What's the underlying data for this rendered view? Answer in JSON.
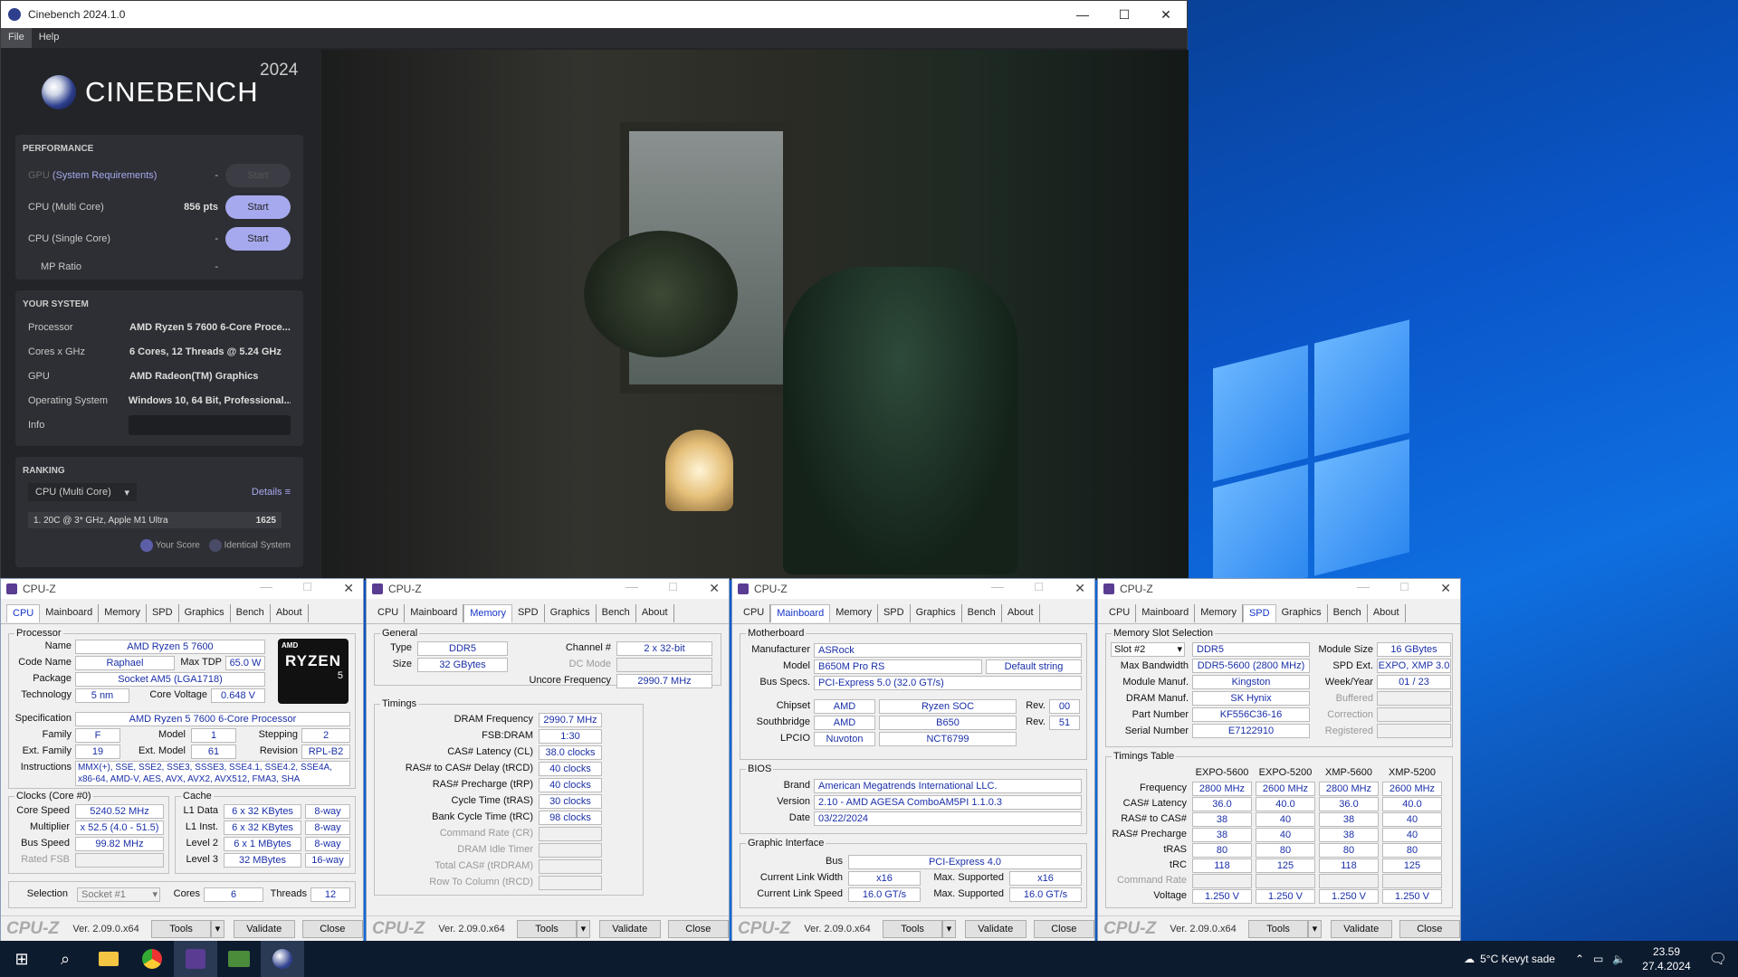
{
  "cinebench": {
    "title": "Cinebench 2024.1.0",
    "menu": [
      "File",
      "Help"
    ],
    "brand": "CINEBENCH",
    "year": "2024",
    "performance": {
      "heading": "PERFORMANCE",
      "rows": [
        {
          "label": "GPU",
          "link": "(System Requirements)",
          "value": "-",
          "button": "Start",
          "enabled": false
        },
        {
          "label": "CPU (Multi Core)",
          "value": "856 pts",
          "button": "Start",
          "enabled": true
        },
        {
          "label": "CPU (Single Core)",
          "value": "-",
          "button": "Start",
          "enabled": true
        },
        {
          "label": "MP Ratio",
          "value": "-"
        }
      ]
    },
    "system": {
      "heading": "YOUR SYSTEM",
      "rows": [
        {
          "k": "Processor",
          "v": "AMD Ryzen 5 7600 6-Core Proce..."
        },
        {
          "k": "Cores x GHz",
          "v": "6 Cores, 12 Threads @ 5.24 GHz"
        },
        {
          "k": "GPU",
          "v": "AMD Radeon(TM) Graphics"
        },
        {
          "k": "Operating System",
          "v": "Windows 10, 64 Bit, Professional..."
        },
        {
          "k": "Info",
          "v": ""
        }
      ]
    },
    "ranking": {
      "heading": "RANKING",
      "dropdown": "CPU (Multi Core)",
      "details": "Details",
      "entry": "1. 20C @ 3* GHz, Apple M1 Ultra",
      "score": "1625",
      "legend_your": "Your Score",
      "legend_identical": "Identical System"
    }
  },
  "cpuz_common": {
    "title": "CPU-Z",
    "tabs": [
      "CPU",
      "Mainboard",
      "Memory",
      "SPD",
      "Graphics",
      "Bench",
      "About"
    ],
    "brand": "CPU-Z",
    "version": "Ver. 2.09.0.x64",
    "tools": "Tools",
    "validate": "Validate",
    "close": "Close"
  },
  "cpu": {
    "g_processor": "Processor",
    "name_l": "Name",
    "name": "AMD Ryzen 5 7600",
    "code_l": "Code Name",
    "code": "Raphael",
    "tdp_l": "Max TDP",
    "tdp": "65.0 W",
    "pkg_l": "Package",
    "pkg": "Socket AM5 (LGA1718)",
    "tech_l": "Technology",
    "tech": "5 nm",
    "cv_l": "Core Voltage",
    "cv": "0.648 V",
    "spec_l": "Specification",
    "spec": "AMD Ryzen 5 7600 6-Core Processor",
    "fam_l": "Family",
    "fam": "F",
    "model_l": "Model",
    "model": "1",
    "step_l": "Stepping",
    "step": "2",
    "efam_l": "Ext. Family",
    "efam": "19",
    "emodel_l": "Ext. Model",
    "emodel": "61",
    "rev_l": "Revision",
    "rev": "RPL-B2",
    "instr_l": "Instructions",
    "instr": "MMX(+), SSE, SSE2, SSE3, SSSE3, SSE4.1, SSE4.2, SSE4A, x86-64, AMD-V, AES, AVX, AVX2, AVX512, FMA3, SHA",
    "clocks": "Clocks (Core #0)",
    "cs_l": "Core Speed",
    "cs": "5240.52 MHz",
    "mul_l": "Multiplier",
    "mul": "x 52.5 (4.0 - 51.5)",
    "bus_l": "Bus Speed",
    "bus": "99.82 MHz",
    "fsb_l": "Rated FSB",
    "cache": "Cache",
    "l1d_l": "L1 Data",
    "l1d": "6 x 32 KBytes",
    "l1d_w": "8-way",
    "l1i_l": "L1 Inst.",
    "l1i": "6 x 32 KBytes",
    "l1i_w": "8-way",
    "l2_l": "Level 2",
    "l2": "6 x 1 MBytes",
    "l2_w": "8-way",
    "l3_l": "Level 3",
    "l3": "32 MBytes",
    "l3_w": "16-way",
    "sel_l": "Selection",
    "sel": "Socket #1",
    "cores_l": "Cores",
    "cores": "6",
    "thr_l": "Threads",
    "thr": "12",
    "logo_top": "AMD",
    "logo_main": "RYZEN",
    "logo_num": "5"
  },
  "mem": {
    "general": "General",
    "type_l": "Type",
    "type": "DDR5",
    "ch_l": "Channel #",
    "ch": "2 x 32-bit",
    "size_l": "Size",
    "size": "32 GBytes",
    "dc_l": "DC Mode",
    "unc_l": "Uncore Frequency",
    "unc": "2990.7 MHz",
    "timings": "Timings",
    "rows": [
      {
        "l": "DRAM Frequency",
        "v": "2990.7 MHz",
        "d": false
      },
      {
        "l": "FSB:DRAM",
        "v": "1:30",
        "d": false
      },
      {
        "l": "CAS# Latency (CL)",
        "v": "38.0 clocks",
        "d": false
      },
      {
        "l": "RAS# to CAS# Delay (tRCD)",
        "v": "40 clocks",
        "d": false
      },
      {
        "l": "RAS# Precharge (tRP)",
        "v": "40 clocks",
        "d": false
      },
      {
        "l": "Cycle Time (tRAS)",
        "v": "30 clocks",
        "d": false
      },
      {
        "l": "Bank Cycle Time (tRC)",
        "v": "98 clocks",
        "d": false
      },
      {
        "l": "Command Rate (CR)",
        "v": "",
        "d": true
      },
      {
        "l": "DRAM Idle Timer",
        "v": "",
        "d": true
      },
      {
        "l": "Total CAS# (tRDRAM)",
        "v": "",
        "d": true
      },
      {
        "l": "Row To Column (tRCD)",
        "v": "",
        "d": true
      }
    ]
  },
  "mb": {
    "motherboard": "Motherboard",
    "manu_l": "Manufacturer",
    "manu": "ASRock",
    "model_l": "Model",
    "model": "B650M Pro RS",
    "model2": "Default string",
    "bus_l": "Bus Specs.",
    "bus": "PCI-Express 5.0 (32.0 GT/s)",
    "chip_l": "Chipset",
    "chip1": "AMD",
    "chip2": "Ryzen SOC",
    "rev_l": "Rev.",
    "chiprev": "00",
    "sb_l": "Southbridge",
    "sb1": "AMD",
    "sb2": "B650",
    "sbrev": "51",
    "lpc_l": "LPCIO",
    "lpc1": "Nuvoton",
    "lpc2": "NCT6799",
    "bios": "BIOS",
    "brand_l": "Brand",
    "brand": "American Megatrends International LLC.",
    "ver_l": "Version",
    "ver": "2.10 - AMD AGESA ComboAM5PI 1.1.0.3",
    "date_l": "Date",
    "date": "03/22/2024",
    "gi": "Graphic Interface",
    "gbus_l": "Bus",
    "gbus": "PCI-Express 4.0",
    "clw_l": "Current Link Width",
    "clw": "x16",
    "msw_l": "Max. Supported",
    "msw": "x16",
    "cls_l": "Current Link Speed",
    "cls": "16.0 GT/s",
    "mss_l": "Max. Supported",
    "mss": "16.0 GT/s"
  },
  "spd": {
    "slotsel": "Memory Slot Selection",
    "slot": "Slot #2",
    "type": "DDR5",
    "msize_l": "Module Size",
    "msize": "16 GBytes",
    "mbw_l": "Max Bandwidth",
    "mbw": "DDR5-5600 (2800 MHz)",
    "spdext_l": "SPD Ext.",
    "spdext": "EXPO, XMP 3.0",
    "mm_l": "Module Manuf.",
    "mm": "Kingston",
    "wy_l": "Week/Year",
    "wy": "01 / 23",
    "dm_l": "DRAM Manuf.",
    "dm": "SK Hynix",
    "buf_l": "Buffered",
    "pn_l": "Part Number",
    "pn": "KF556C36-16",
    "corr_l": "Correction",
    "sn_l": "Serial Number",
    "sn": "E7122910",
    "reg_l": "Registered",
    "tt": "Timings Table",
    "cols": [
      "EXPO-5600",
      "EXPO-5200",
      "XMP-5600",
      "XMP-5200"
    ],
    "rows": [
      {
        "l": "Frequency",
        "v": [
          "2800 MHz",
          "2600 MHz",
          "2800 MHz",
          "2600 MHz"
        ],
        "d": false
      },
      {
        "l": "CAS# Latency",
        "v": [
          "36.0",
          "40.0",
          "36.0",
          "40.0"
        ],
        "d": false
      },
      {
        "l": "RAS# to CAS#",
        "v": [
          "38",
          "40",
          "38",
          "40"
        ],
        "d": false
      },
      {
        "l": "RAS# Precharge",
        "v": [
          "38",
          "40",
          "38",
          "40"
        ],
        "d": false
      },
      {
        "l": "tRAS",
        "v": [
          "80",
          "80",
          "80",
          "80"
        ],
        "d": false
      },
      {
        "l": "tRC",
        "v": [
          "118",
          "125",
          "118",
          "125"
        ],
        "d": false
      },
      {
        "l": "Command Rate",
        "v": [
          "",
          "",
          "",
          ""
        ],
        "d": true
      },
      {
        "l": "Voltage",
        "v": [
          "1.250 V",
          "1.250 V",
          "1.250 V",
          "1.250 V"
        ],
        "d": false
      }
    ]
  },
  "taskbar": {
    "weather": "5°C  Kevyt sade",
    "time": "23.59",
    "date": "27.4.2024"
  }
}
